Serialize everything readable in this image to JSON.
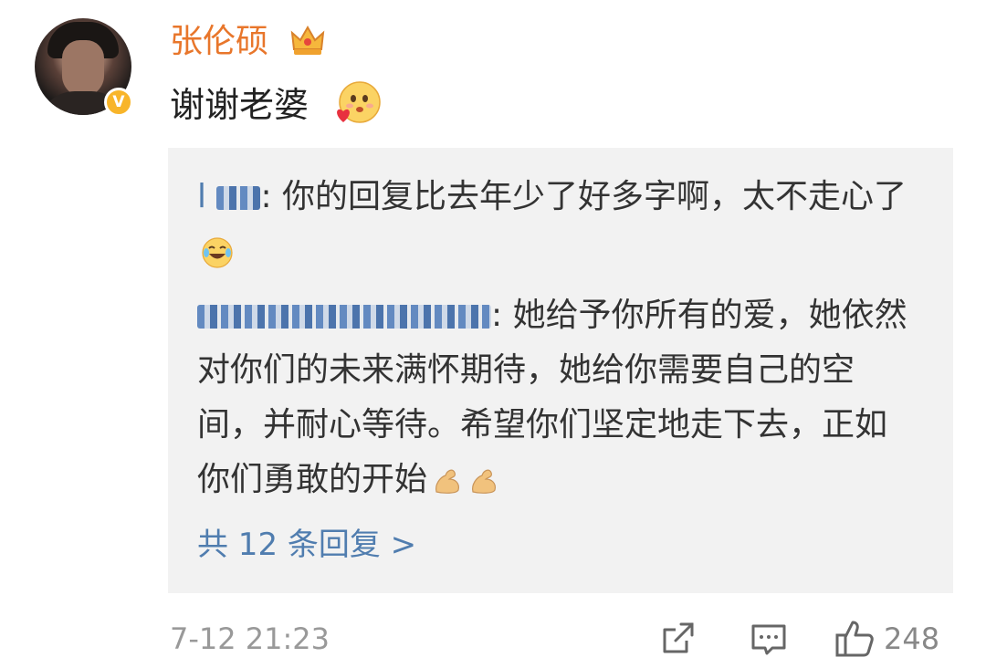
{
  "post": {
    "username": "张伦硕",
    "comment": "谢谢老婆",
    "timestamp": "7-12 21:23",
    "like_count": "248"
  },
  "replies": [
    {
      "text": ": 你的回复比去年少了好多字啊，太不走心了"
    },
    {
      "text": ": 她给予你所有的爱，她依然对你们的未来满怀期待，她给你需要自己的空间，并耐心等待。希望你们坚定地走下去，正如你们勇敢的开始"
    }
  ],
  "more_replies_label": "共 12 条回复 >",
  "colors": {
    "username": "#e8762b",
    "link": "#507daf",
    "reply_bg": "#f2f2f2",
    "meta": "#999999",
    "verified": "#f8b52a"
  },
  "icons": [
    "crown-icon",
    "kiss-heart-emoji",
    "laugh-cry-emoji",
    "flex-arm-emoji",
    "share-icon",
    "comment-icon",
    "like-icon",
    "verified-badge-icon"
  ]
}
